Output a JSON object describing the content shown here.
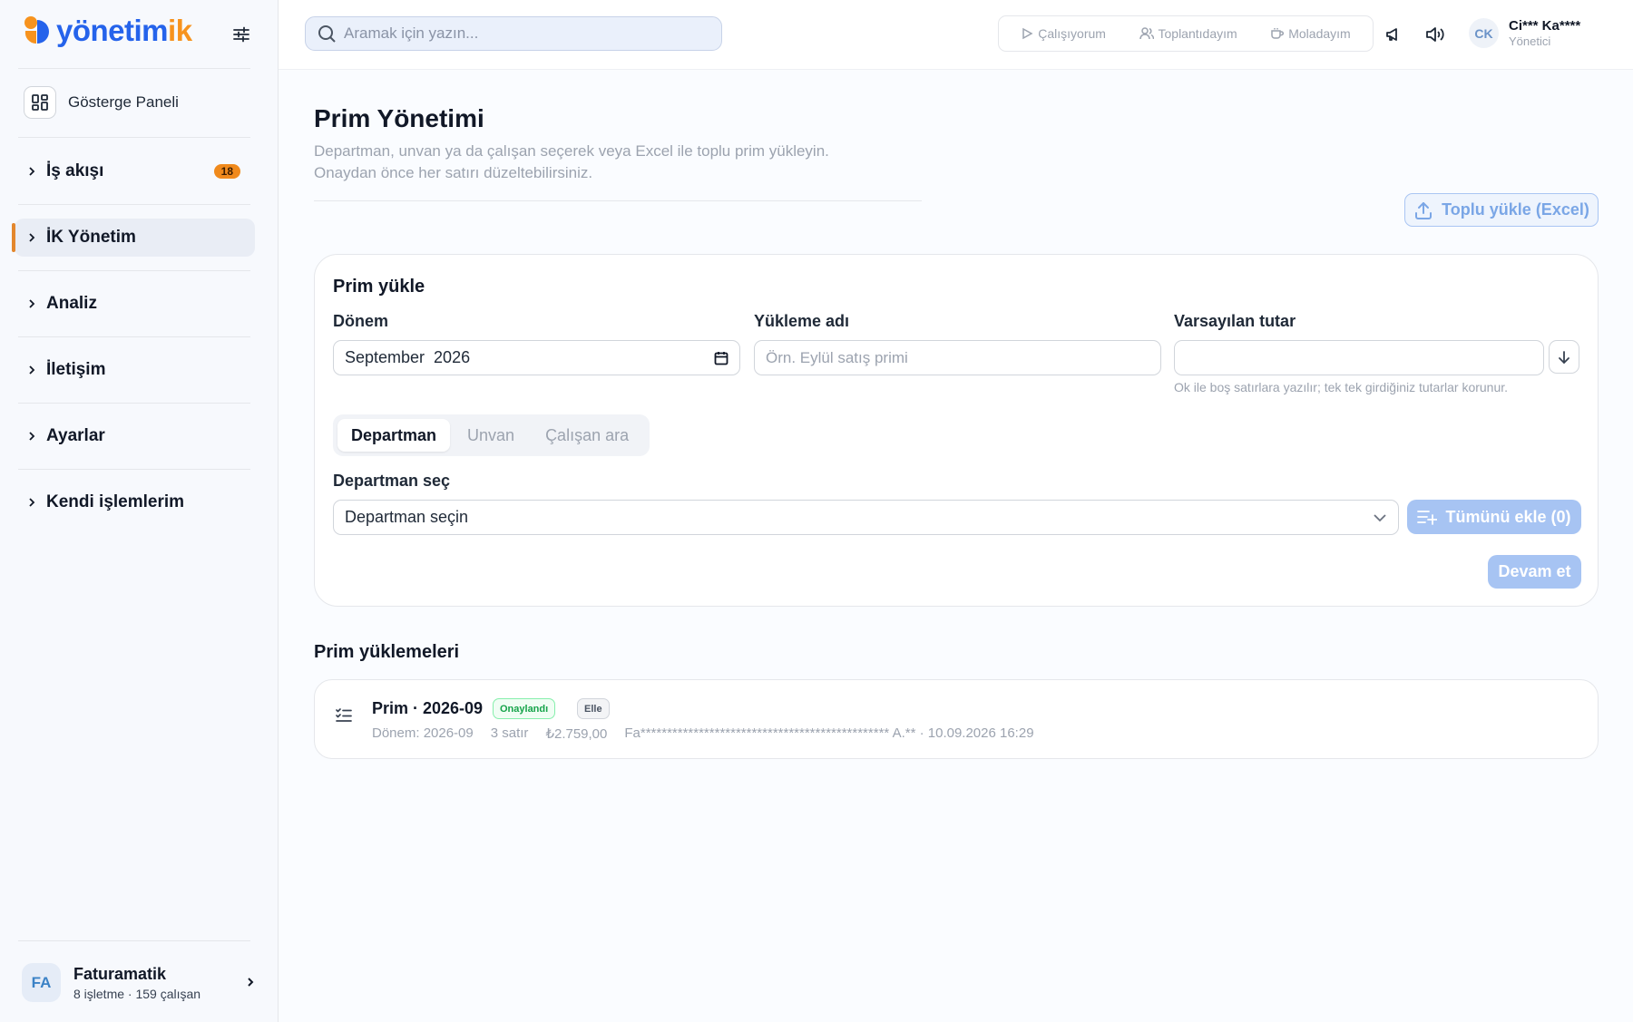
{
  "brand": {
    "text_main": "yönetim",
    "text_accent": "ik",
    "colors": {
      "blue": "#2563eb",
      "orange": "#f7931e"
    }
  },
  "sidebar": {
    "dashboard_label": "Gösterge Paneli",
    "items": [
      {
        "label": "İş akışı",
        "badge": "18",
        "active": false
      },
      {
        "label": "İK Yönetim",
        "active": true
      },
      {
        "label": "Analiz",
        "active": false
      },
      {
        "label": "İletişim",
        "active": false
      },
      {
        "label": "Ayarlar",
        "active": false
      },
      {
        "label": "Kendi işlemlerim",
        "active": false
      }
    ],
    "org": {
      "initials": "FA",
      "name": "Faturamatik",
      "sub": "8 işletme · 159 çalışan"
    }
  },
  "topbar": {
    "search_placeholder": "Aramak için yazın...",
    "statuses": [
      "Çalışıyorum",
      "Toplantıdayım",
      "Moladayım"
    ],
    "user": {
      "initials": "CK",
      "name": "Ci*** Ka****",
      "role": "Yönetici"
    }
  },
  "page": {
    "title": "Prim Yönetimi",
    "description": "Departman, unvan ya da çalışan seçerek veya Excel ile toplu prim yükleyin. Onaydan önce her satırı düzeltebilirsiniz.",
    "bulk_upload_label": "Toplu yükle (Excel)"
  },
  "form": {
    "title": "Prim yükle",
    "period_label": "Dönem",
    "period_value": "September  2026",
    "upload_name_label": "Yükleme adı",
    "upload_name_placeholder": "Örn. Eylül satış primi",
    "default_amount_label": "Varsayılan tutar",
    "default_amount_value": "",
    "hint": "Ok ile boş satırlara yazılır; tek tek girdiğiniz tutarlar korunur.",
    "tabs": [
      "Departman",
      "Unvan",
      "Çalışan ara"
    ],
    "active_tab": "Departman",
    "dept_label": "Departman seç",
    "dept_value": "Departman seçin",
    "add_all_label": "Tümünü ekle (0)",
    "continue_label": "Devam et"
  },
  "uploads": {
    "title": "Prim yüklemeleri",
    "items": [
      {
        "title": "Prim · 2026-09",
        "status": "Onaylandı",
        "type": "Elle",
        "period": "Dönem: 2026-09",
        "rows": "3 satır",
        "amount": "₺2.759,00",
        "by": "Fa*********************************************** A.** · 10.09.2026 16:29"
      }
    ]
  }
}
